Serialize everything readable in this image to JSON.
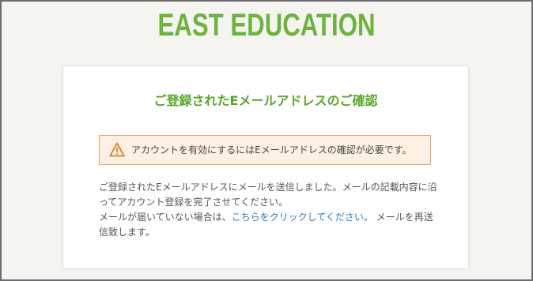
{
  "logo": {
    "text": "EAST EDUCATION"
  },
  "card": {
    "title": "ご登録されたEメールアドレスのご確認",
    "alert": {
      "icon": "warning-triangle-icon",
      "text": "アカウントを有効にするにはEメールアドレスの確認が必要です。"
    },
    "paragraph1": "ご登録されたEメールアドレスにメールを送信しました。メールの記載内容に沿ってアカウント登録を完了させてください。",
    "paragraph2_before": "メールが届いていない場合は、",
    "paragraph2_link": "こちらをクリックしてください。",
    "paragraph2_after": " メールを再送信致します。"
  },
  "colors": {
    "brand_green": "#6cb33f",
    "title_green": "#5aa52a",
    "alert_bg": "#fdf1e5",
    "alert_border": "#e6a065",
    "warning_orange": "#e07a1f",
    "link_blue": "#2a7bbd",
    "page_bg": "#f5f4f0"
  }
}
